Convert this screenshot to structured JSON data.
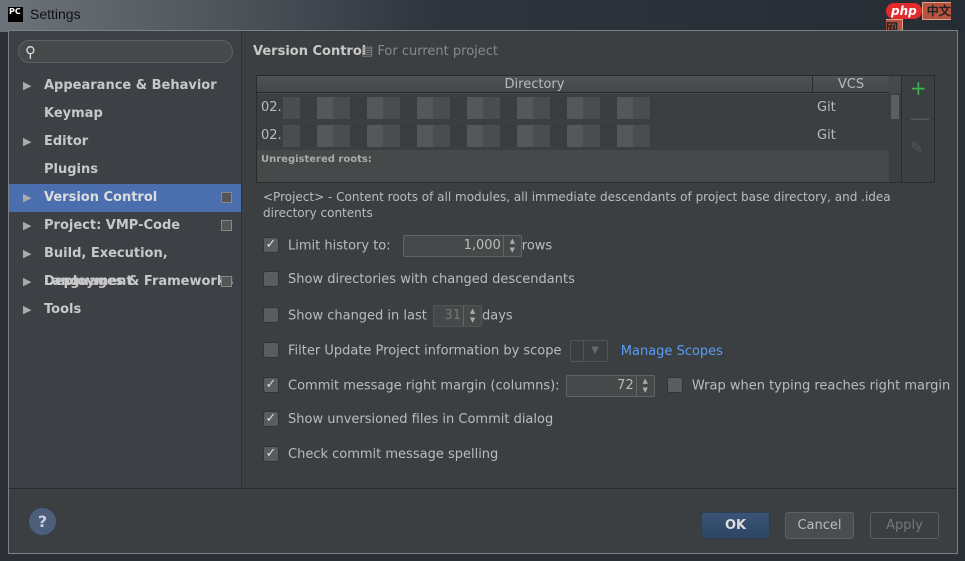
{
  "window": {
    "title": "Settings",
    "app_icon": "PC",
    "watermark": "php中文网"
  },
  "sidebar": {
    "search_placeholder": "",
    "items": [
      {
        "label": "Appearance & Behavior",
        "expandable": true
      },
      {
        "label": "Keymap",
        "expandable": false
      },
      {
        "label": "Editor",
        "expandable": true
      },
      {
        "label": "Plugins",
        "expandable": false
      },
      {
        "label": "Version Control",
        "expandable": true,
        "selected": true,
        "project_icon": true
      },
      {
        "label": "Project: VMP-Code",
        "expandable": true,
        "project_icon": true
      },
      {
        "label": "Build, Execution, Deployment",
        "expandable": true
      },
      {
        "label": "Languages & Frameworks",
        "expandable": true,
        "project_icon": true
      },
      {
        "label": "Tools",
        "expandable": true
      }
    ]
  },
  "main": {
    "title": "Version Control",
    "scope": "For current project",
    "table": {
      "headers": [
        "Directory",
        "VCS"
      ],
      "rows": [
        {
          "dir": "02.",
          "vcs": "Git"
        },
        {
          "dir": "02.",
          "vcs": "Git"
        }
      ],
      "unregistered": "Unregistered roots:"
    },
    "description": "<Project> - Content roots of all modules, all immediate descendants of project base directory, and .idea directory contents",
    "options": {
      "limit_history": {
        "label": "Limit history to:",
        "checked": true,
        "value": "1,000",
        "suffix": "rows"
      },
      "show_dirs": {
        "label": "Show directories with changed descendants",
        "checked": false
      },
      "show_changed": {
        "label": "Show changed in last",
        "checked": false,
        "value": "31",
        "suffix": "days"
      },
      "filter_scope": {
        "label": "Filter Update Project information by scope",
        "checked": false,
        "link": "Manage Scopes"
      },
      "commit_margin": {
        "label": "Commit message right margin (columns):",
        "checked": true,
        "value": "72"
      },
      "wrap": {
        "label": "Wrap when typing reaches right margin",
        "checked": false
      },
      "show_unversioned": {
        "label": "Show unversioned files in Commit dialog",
        "checked": true
      },
      "check_spelling": {
        "label": "Check commit message spelling",
        "checked": true
      }
    }
  },
  "footer": {
    "help": "?",
    "ok": "OK",
    "cancel": "Cancel",
    "apply": "Apply"
  }
}
